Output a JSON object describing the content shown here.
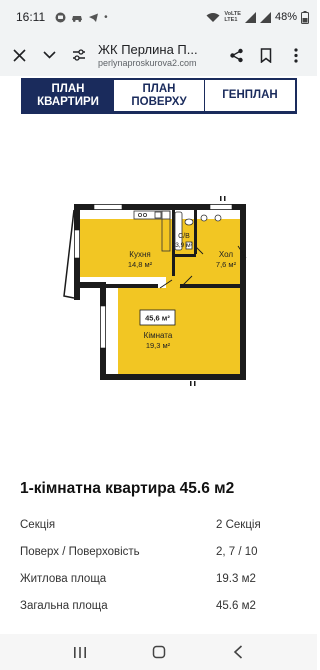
{
  "status_bar": {
    "time": "16:11",
    "network_label_top": "VoLTE",
    "network_label_bottom": "LTE1",
    "battery": "48%"
  },
  "browser": {
    "page_title": "ЖК Перлина П...",
    "url": "perlynaproskurova2.com"
  },
  "tabs": [
    {
      "label": "ПЛАН КВАРТИРИ",
      "active": true
    },
    {
      "label": "ПЛАН ПОВЕРХУ",
      "active": false
    },
    {
      "label": "ГЕНПЛАН",
      "active": false
    }
  ],
  "plan": {
    "rooms": {
      "kitchen_name": "Кухня",
      "kitchen_area": "14,8 м²",
      "bath_name": "С/В",
      "bath_area": "3,9 м²",
      "hall_name": "Хол",
      "hall_area": "7,6 м²",
      "room_name": "Кімната",
      "room_area": "19,3 м²",
      "total_area": "45,6 м²"
    },
    "colors": {
      "room_fill": "#f2c623",
      "wall": "#1b1b1b"
    }
  },
  "apartment": {
    "title": "1-кімнатна квартира 45.6 м2",
    "rows": [
      {
        "label": "Секція",
        "value": "2 Секція"
      },
      {
        "label": "Поверх / Поверховість",
        "value": "2, 7 / 10"
      },
      {
        "label": "Житлова площа",
        "value": "19.3 м2"
      },
      {
        "label": "Загальна площа",
        "value": "45.6 м2"
      }
    ]
  },
  "icons": [
    "close-icon",
    "chevron-down-icon",
    "site-settings-icon",
    "share-icon",
    "bookmark-icon",
    "more-vert-icon",
    "recents-icon",
    "home-icon",
    "back-icon"
  ]
}
